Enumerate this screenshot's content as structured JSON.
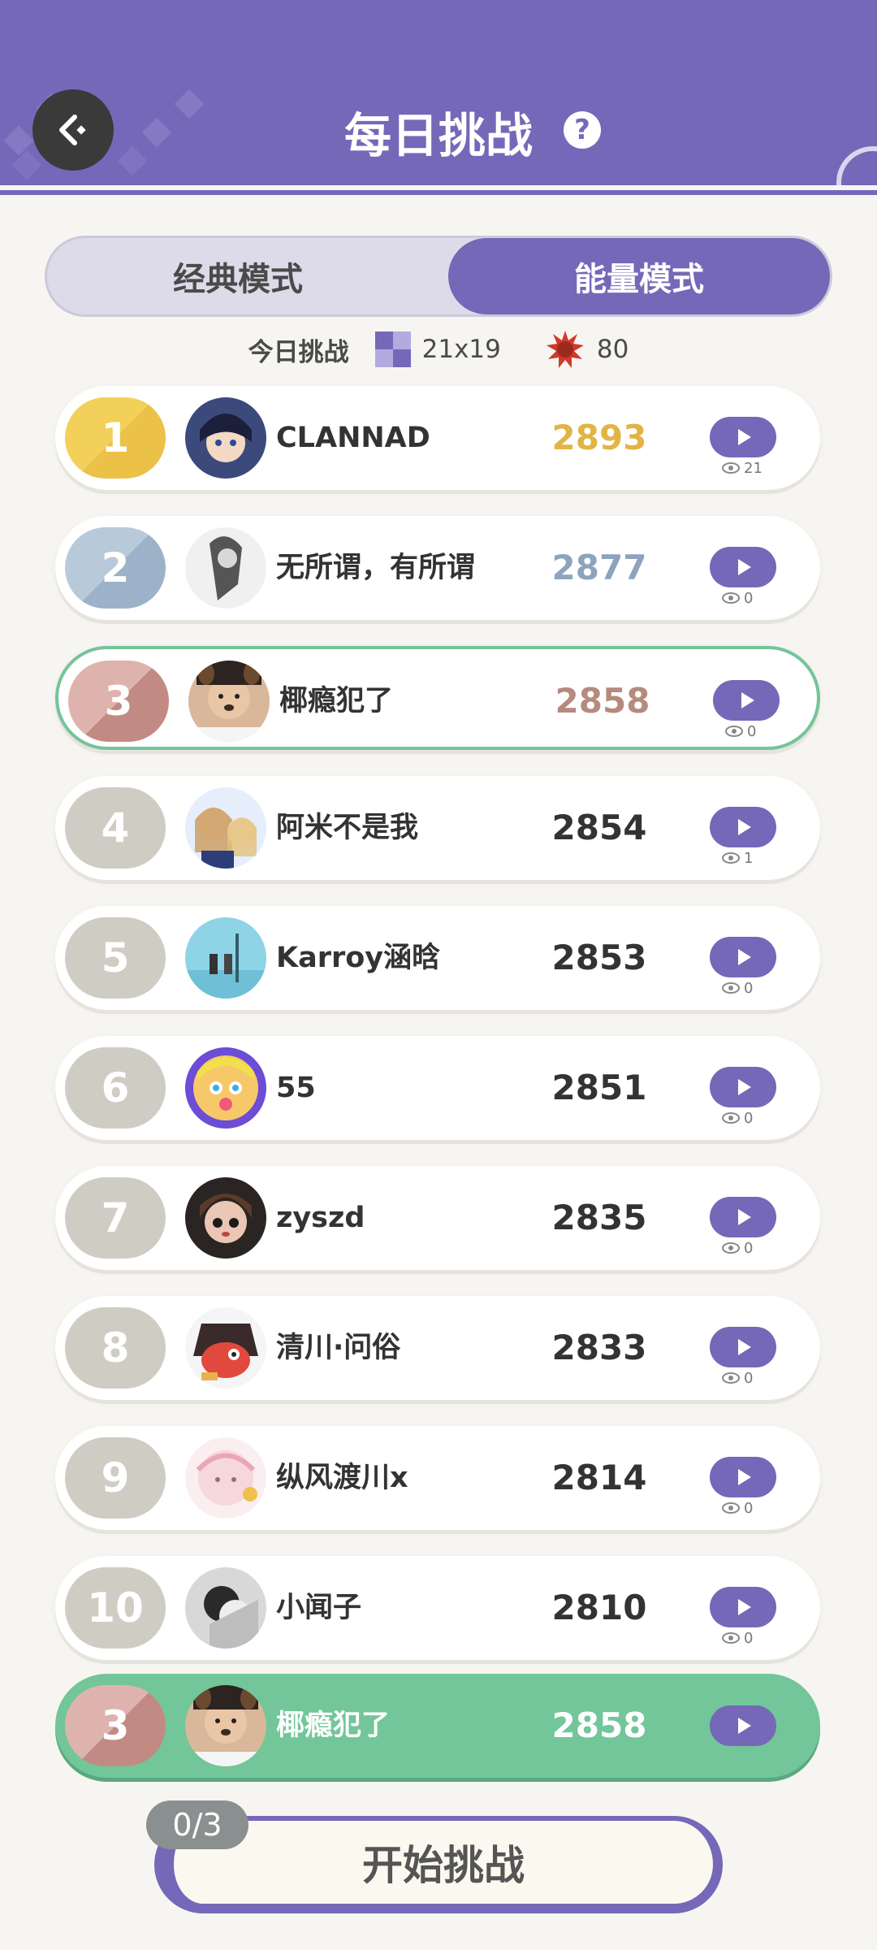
{
  "header": {
    "title": "每日挑战",
    "help_symbol": "?"
  },
  "modes": {
    "classic": "经典模式",
    "energy": "能量模式",
    "selected": "能量模式"
  },
  "today": {
    "label": "今日挑战",
    "grid_size": "21x19",
    "energy": "80"
  },
  "rows": [
    {
      "rank": "1",
      "name": "CLANNAD",
      "score": "2893",
      "views": "21",
      "tier": "gold"
    },
    {
      "rank": "2",
      "name": "无所谓，有所谓",
      "score": "2877",
      "views": "0",
      "tier": "silver"
    },
    {
      "rank": "3",
      "name": "椰瘾犯了",
      "score": "2858",
      "views": "0",
      "tier": "bronze"
    },
    {
      "rank": "4",
      "name": "阿米不是我",
      "score": "2854",
      "views": "1",
      "tier": "plain"
    },
    {
      "rank": "5",
      "name": "Karroy涵晗",
      "score": "2853",
      "views": "0",
      "tier": "plain"
    },
    {
      "rank": "6",
      "name": "55",
      "score": "2851",
      "views": "0",
      "tier": "plain"
    },
    {
      "rank": "7",
      "name": "zyszd",
      "score": "2835",
      "views": "0",
      "tier": "plain"
    },
    {
      "rank": "8",
      "name": "清川·问俗",
      "score": "2833",
      "views": "0",
      "tier": "plain"
    },
    {
      "rank": "9",
      "name": "纵风渡川x",
      "score": "2814",
      "views": "0",
      "tier": "plain"
    },
    {
      "rank": "10",
      "name": "小闻子",
      "score": "2810",
      "views": "0",
      "tier": "plain"
    }
  ],
  "my_row": {
    "rank": "3",
    "name": "椰瘾犯了",
    "score": "2858"
  },
  "bottom": {
    "attempts": "0/3",
    "start_label": "开始挑战"
  },
  "colors": {
    "accent": "#7568b8",
    "highlight": "#72c699",
    "gold": "#e2b445",
    "silver": "#8ea3bd",
    "bronze": "#b68a7e"
  }
}
